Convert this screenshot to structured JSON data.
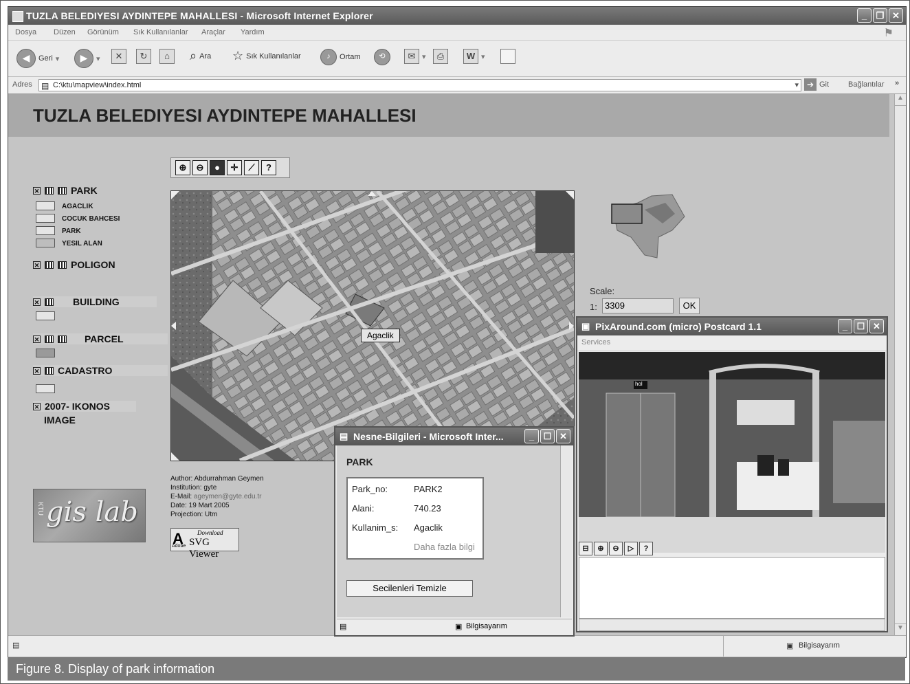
{
  "window": {
    "title": "TUZLA BELEDIYESI AYDINTEPE MAHALLESI - Microsoft Internet Explorer"
  },
  "menu": [
    "Dosya",
    "Düzen",
    "Görünüm",
    "Sık Kullanılanlar",
    "Araçlar",
    "Yardım"
  ],
  "toolbar": {
    "back": "Geri",
    "search": "Ara",
    "favorites": "Sık Kullanılanlar",
    "media": "Ortam"
  },
  "address": {
    "label": "Adres",
    "url": "C:\\ktu\\mapview\\index.html",
    "go": "Git",
    "links": "Bağlantılar"
  },
  "page": {
    "title": "TUZLA BELEDIYESI AYDINTEPE MAHALLESI",
    "layers": {
      "park": "PARK",
      "park_legend": [
        "AGACLIK",
        "COCUK BAHCESI",
        "PARK",
        "YESIL ALAN"
      ],
      "poligon": "POLIGON",
      "building": "BUILDING",
      "parcel": "PARCEL",
      "cadastro": "CADASTRO",
      "ikonos_1": "2007- IKONOS",
      "ikonos_2": "IMAGE"
    },
    "map_label": "Agaclik",
    "credits": {
      "author": "Author: Abdurrahman Geymen",
      "institution": "Institution: gyte",
      "email_label": "E-Mail:",
      "email": "ageymen@gyte.edu.tr",
      "date": "Date: 19 Mart 2005",
      "projection": "Projection: Utm"
    },
    "logo_text": "gis lab",
    "logo_side": "KTU",
    "svg_viewer": {
      "download": "Download",
      "name": "SVG Viewer",
      "brand": "Adobe"
    },
    "scale": {
      "label": "Scale:",
      "prefix": "1:",
      "value": "3309",
      "ok": "OK"
    }
  },
  "info_popup": {
    "title": "Nesne-Bilgileri - Microsoft Inter...",
    "heading": "PARK",
    "rows": [
      {
        "key": "Park_no:",
        "value": "PARK2"
      },
      {
        "key": "Alani:",
        "value": "740.23"
      },
      {
        "key": "Kullanim_s:",
        "value": "Agaclik"
      }
    ],
    "more": "Daha fazla bilgi",
    "clear_button": "Secilenleri Temizle",
    "status": "Bilgisayarım"
  },
  "pix_popup": {
    "title": "PixAround.com (micro) Postcard 1.1",
    "menu": "Services",
    "booth_sign": "hol"
  },
  "status": {
    "zone": "Bilgisayarım"
  },
  "caption": "Figure 8. Display of park information"
}
